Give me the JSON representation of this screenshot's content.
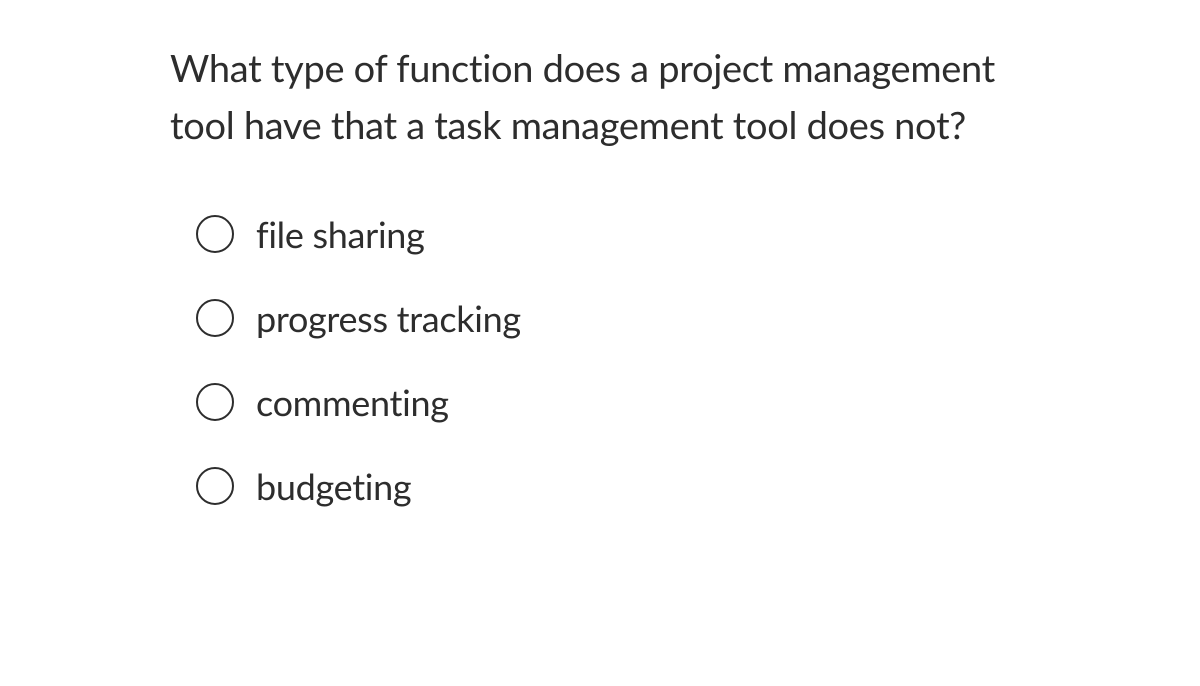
{
  "question": {
    "text": "What type of function does a project management tool have that a task management tool does not?",
    "options": [
      {
        "label": "file sharing"
      },
      {
        "label": "progress tracking"
      },
      {
        "label": "commenting"
      },
      {
        "label": "budgeting"
      }
    ]
  }
}
